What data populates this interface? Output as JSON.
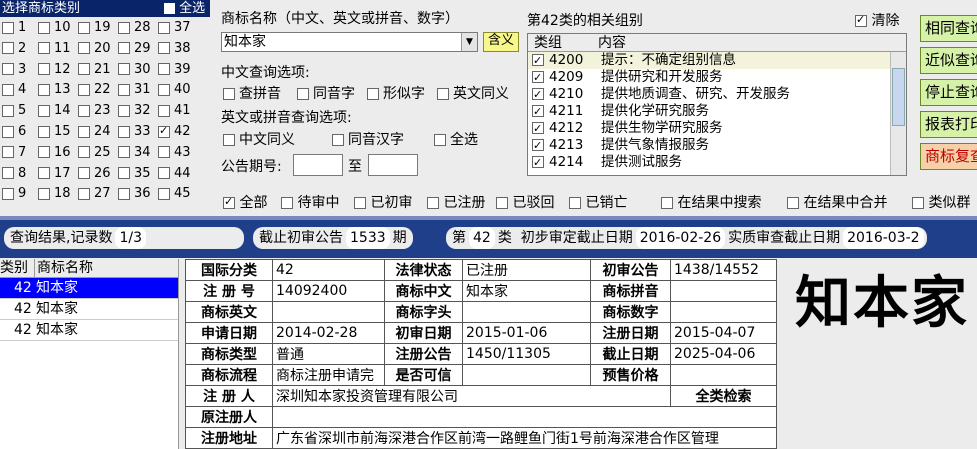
{
  "category_panel": {
    "title": "选择商标类别",
    "select_all_label": "全选",
    "columns": [
      {
        "items": [
          {
            "num": "1"
          },
          {
            "num": "2"
          },
          {
            "num": "3"
          },
          {
            "num": "4"
          },
          {
            "num": "5"
          },
          {
            "num": "6"
          },
          {
            "num": "7"
          },
          {
            "num": "8"
          },
          {
            "num": "9"
          }
        ]
      },
      {
        "items": [
          {
            "num": "10"
          },
          {
            "num": "11"
          },
          {
            "num": "12"
          },
          {
            "num": "13"
          },
          {
            "num": "14"
          },
          {
            "num": "15"
          },
          {
            "num": "16"
          },
          {
            "num": "17"
          },
          {
            "num": "18"
          }
        ]
      },
      {
        "items": [
          {
            "num": "19"
          },
          {
            "num": "20"
          },
          {
            "num": "21"
          },
          {
            "num": "22"
          },
          {
            "num": "23"
          },
          {
            "num": "24"
          },
          {
            "num": "25"
          },
          {
            "num": "26"
          },
          {
            "num": "27"
          }
        ]
      },
      {
        "items": [
          {
            "num": "28"
          },
          {
            "num": "29"
          },
          {
            "num": "30"
          },
          {
            "num": "31"
          },
          {
            "num": "32"
          },
          {
            "num": "33"
          },
          {
            "num": "34"
          },
          {
            "num": "35"
          },
          {
            "num": "36"
          }
        ]
      },
      {
        "items": [
          {
            "num": "37"
          },
          {
            "num": "38"
          },
          {
            "num": "39"
          },
          {
            "num": "40"
          },
          {
            "num": "41"
          },
          {
            "num": "42",
            "checked": true
          },
          {
            "num": "43"
          },
          {
            "num": "44"
          },
          {
            "num": "45"
          }
        ]
      }
    ]
  },
  "search": {
    "name_label": "商标名称（中文、英文或拼音、数字）",
    "name_value": "知本家",
    "meaning_button": "含义",
    "cn_options_label": "中文查询选项:",
    "cn_options": [
      "查拼音",
      "同音字",
      "形似字",
      "英文同义"
    ],
    "en_options_label": "英文或拼音查询选项:",
    "en_options": [
      "中文同义",
      "同音汉字",
      "全选"
    ],
    "period_label": "公告期号:",
    "period_to": "至",
    "period_from_value": "",
    "period_to_value": ""
  },
  "group_panel": {
    "title": "第42类的相关组别",
    "clear_label": "清除",
    "col_group": "类组",
    "col_content": "内容",
    "rows": [
      {
        "code": "4200",
        "text": "提示：不确定组别信息"
      },
      {
        "code": "4209",
        "text": "提供研究和开发服务"
      },
      {
        "code": "4210",
        "text": "提供地质调查、研究、开发服务"
      },
      {
        "code": "4211",
        "text": "提供化学研究服务"
      },
      {
        "code": "4212",
        "text": "提供生物学研究服务"
      },
      {
        "code": "4213",
        "text": "提供气象情报服务"
      },
      {
        "code": "4214",
        "text": "提供测试服务"
      }
    ]
  },
  "side_buttons": [
    "相同查询",
    "近似查询",
    "停止查询",
    "报表打印",
    "商标复查"
  ],
  "status_filters": {
    "items": [
      {
        "label": "全部",
        "checked": true
      },
      {
        "label": "待审中"
      },
      {
        "label": "已初审"
      },
      {
        "label": "已注册"
      },
      {
        "label": "已驳回"
      },
      {
        "label": "已销亡"
      }
    ],
    "extra": [
      "在结果中搜索",
      "在结果中合并",
      "类似群"
    ]
  },
  "info_bar": {
    "results_label": "查询结果,记录数",
    "results_value": "1/3",
    "deadline_label": "截止初审公告",
    "deadline_value": "1533",
    "deadline_unit": "期",
    "class_prefix": "第",
    "class_value": "42",
    "class_suffix": "类",
    "prelim_label": "初步审定截止日期",
    "prelim_value": "2016-02-26",
    "substantive_label": "实质审查截止日期",
    "substantive_value": "2016-03-2"
  },
  "result_list": {
    "col_class": "类别",
    "col_name": "商标名称",
    "rows": [
      {
        "class": "42",
        "name": "知本家",
        "selected": true
      },
      {
        "class": "42",
        "name": "知本家"
      },
      {
        "class": "42",
        "name": "知本家"
      }
    ]
  },
  "detail": {
    "intl_class_k": "国际分类",
    "intl_class_v": "42",
    "legal_status_k": "法律状态",
    "legal_status_v": "已注册",
    "prelim_pub_k": "初审公告",
    "prelim_pub_v": "1438/14552",
    "reg_no_k": "注 册 号",
    "reg_no_v": "14092400",
    "name_cn_k": "商标中文",
    "name_cn_v": "知本家",
    "pinyin_k": "商标拼音",
    "pinyin_v": "",
    "name_en_k": "商标英文",
    "name_en_v": "",
    "initials_k": "商标字头",
    "initials_v": "",
    "digits_k": "商标数字",
    "digits_v": "",
    "apply_date_k": "申请日期",
    "apply_date_v": "2014-02-28",
    "prelim_date_k": "初审日期",
    "prelim_date_v": "2015-01-06",
    "reg_date_k": "注册日期",
    "reg_date_v": "2015-04-07",
    "type_k": "商标类型",
    "type_v": "普通",
    "reg_pub_k": "注册公告",
    "reg_pub_v": "1450/11305",
    "expire_k": "截止日期",
    "expire_v": "2025-04-06",
    "flow_k": "商标流程",
    "flow_v": "商标注册申请完",
    "trusted_k": "是否可信",
    "trusted_v": "",
    "presale_k": "预售价格",
    "presale_v": "",
    "registrant_k": "注 册 人",
    "registrant_v": "深圳知本家投资管理有限公司",
    "full_search": "全类检索",
    "orig_registrant_k": "原注册人",
    "orig_registrant_v": "",
    "address_k": "注册地址",
    "address_v": "广东省深圳市前海深港合作区前湾一路鲤鱼门街1号前海深港合作区管理"
  },
  "logo_text": "知本家"
}
